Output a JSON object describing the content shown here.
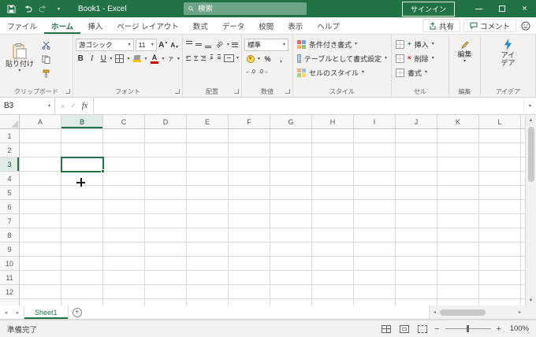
{
  "colors": {
    "accent": "#217346",
    "titlebar": "#217346",
    "selection_border": "#217346"
  },
  "titlebar": {
    "title": "Book1 - Excel",
    "search_placeholder": "検索",
    "signin_label": "サインイン"
  },
  "tabrow": {
    "tabs": [
      {
        "label": "ファイル"
      },
      {
        "label": "ホーム"
      },
      {
        "label": "挿入"
      },
      {
        "label": "ページ レイアウト"
      },
      {
        "label": "数式"
      },
      {
        "label": "データ"
      },
      {
        "label": "校閲"
      },
      {
        "label": "表示"
      },
      {
        "label": "ヘルプ"
      }
    ],
    "share_label": "共有",
    "comments_label": "コメント"
  },
  "ribbon": {
    "clipboard": {
      "group_label": "クリップボード",
      "paste_label": "貼り付け"
    },
    "font": {
      "group_label": "フォント",
      "font_name": "游ゴシック",
      "font_size": "11",
      "bold": "B",
      "italic": "I",
      "underline": "U",
      "grow": "A",
      "shrink": "A",
      "color_letter": "A",
      "ruby": "ァ"
    },
    "alignment": {
      "group_label": "配置",
      "orientation_text": "ab"
    },
    "number": {
      "group_label": "数値",
      "format": "標準",
      "currency": "¥",
      "percent": "%",
      "comma": ",",
      "increase_decimal": "←.0",
      "decrease_decimal": ".0→"
    },
    "styles": {
      "group_label": "スタイル",
      "conditional_label": "条件付き書式",
      "format_table_label": "テーブルとして書式設定",
      "cell_styles_label": "セルのスタイル"
    },
    "cells": {
      "group_label": "セル",
      "insert_label": "挿入",
      "delete_label": "削除",
      "format_label": "書式"
    },
    "editing": {
      "group_label": "編集",
      "button_label": "編集"
    },
    "ideas": {
      "group_label": "アイデア",
      "button_label": "アイデア"
    }
  },
  "formula_bar": {
    "name_box": "B3",
    "fx": "fx",
    "value": ""
  },
  "grid": {
    "columns": [
      "A",
      "B",
      "C",
      "D",
      "E",
      "F",
      "G",
      "H",
      "I",
      "J",
      "K",
      "L"
    ],
    "rows": [
      "1",
      "2",
      "3",
      "4",
      "5",
      "6",
      "7",
      "8",
      "9",
      "10",
      "11",
      "12"
    ],
    "selected_cell": "B3"
  },
  "sheet_bar": {
    "sheet_name": "Sheet1"
  },
  "status_bar": {
    "mode": "準備完了",
    "zoom_level": "100%"
  },
  "glyphs": {
    "dropdown": "▾",
    "up": "▲",
    "down": "▼",
    "left": "◂",
    "right": "▸",
    "close": "×",
    "cancel": "×",
    "check": "✓",
    "add": "+",
    "zoom_out": "−",
    "zoom_in": "+"
  }
}
